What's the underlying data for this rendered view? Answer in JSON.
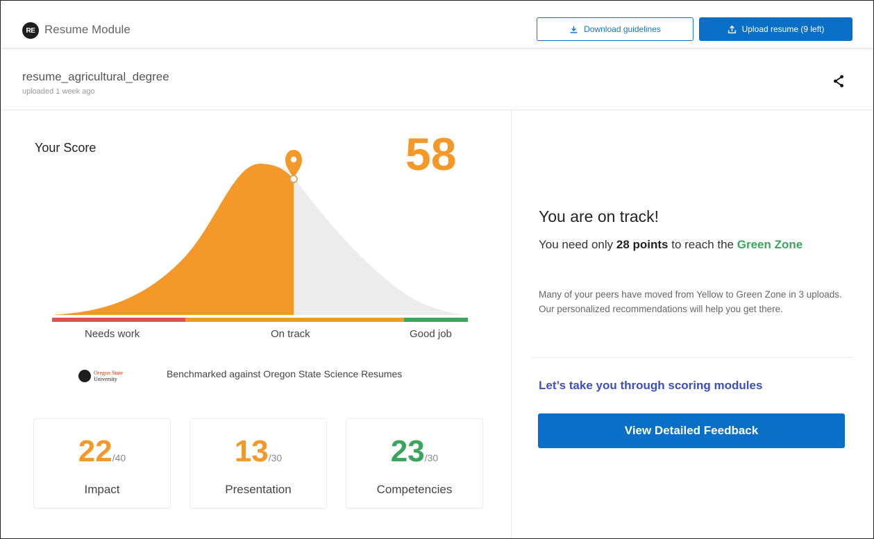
{
  "header": {
    "logo_text": "RE",
    "app_title": "Resume Module",
    "download_button": "Download guidelines",
    "upload_button": "Upload resume (9 left)"
  },
  "file": {
    "name": "resume_agricultural_degree",
    "uploaded": "uploaded 1 week ago"
  },
  "score": {
    "label": "Your Score",
    "value": "58",
    "zones": {
      "needs_work": "Needs work",
      "on_track": "On track",
      "good_job": "Good job"
    },
    "benchmark_text": "Benchmarked against Oregon State Science Resumes",
    "benchmark_logo": {
      "line1": "Oregon State",
      "line2": "University"
    },
    "colors": {
      "fill": "#f4982a",
      "rest": "#ececec",
      "needs_work": "#d9534f",
      "on_track": "#f4982a",
      "good_job": "#3aa55d"
    }
  },
  "cards": [
    {
      "value": "22",
      "max": "/40",
      "label": "Impact",
      "color": "#f4982a"
    },
    {
      "value": "13",
      "max": "/30",
      "label": "Presentation",
      "color": "#f4982a"
    },
    {
      "value": "23",
      "max": "/30",
      "label": "Competencies",
      "color": "#3aa55d"
    }
  ],
  "panel": {
    "title": "You are on track!",
    "line_prefix": "You need only ",
    "line_points": "28 points",
    "line_mid": " to reach the ",
    "line_zone": "Green Zone",
    "paragraph": "Many of your peers have moved from Yellow to Green Zone in 3 uploads. Our personalized recommendations will help you get there.",
    "link": "Let’s take you through scoring modules",
    "feedback_button": "View Detailed Feedback"
  },
  "icons": {
    "download": "download-icon",
    "upload": "upload-icon",
    "share": "share-icon",
    "marker": "location-pin-icon"
  }
}
